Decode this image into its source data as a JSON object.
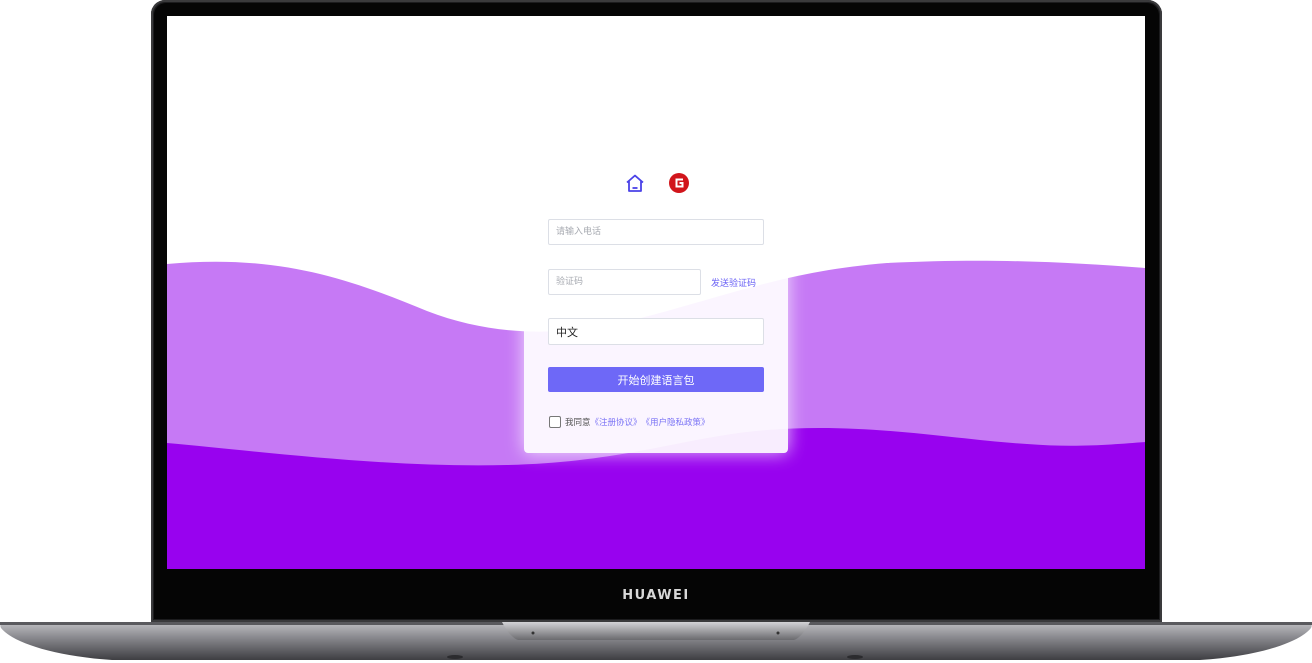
{
  "device": {
    "brand": "HUAWEI"
  },
  "colors": {
    "wave_light": "#c679f5",
    "wave_dark": "#9802ef",
    "accent": "#6e68f7",
    "logo_home": "#4a42e8",
    "logo_g": "#d1151b"
  },
  "login": {
    "icons": [
      "home-icon",
      "g-logo-icon"
    ],
    "phone_placeholder": "请输入电话",
    "code_placeholder": "验证码",
    "send_code_label": "发送验证码",
    "language_value": "中文",
    "submit_label": "开始创建语言包",
    "agree_prefix": "我同意",
    "agreement_link": "《注册协议》",
    "privacy_link": "《用户隐私政策》"
  }
}
